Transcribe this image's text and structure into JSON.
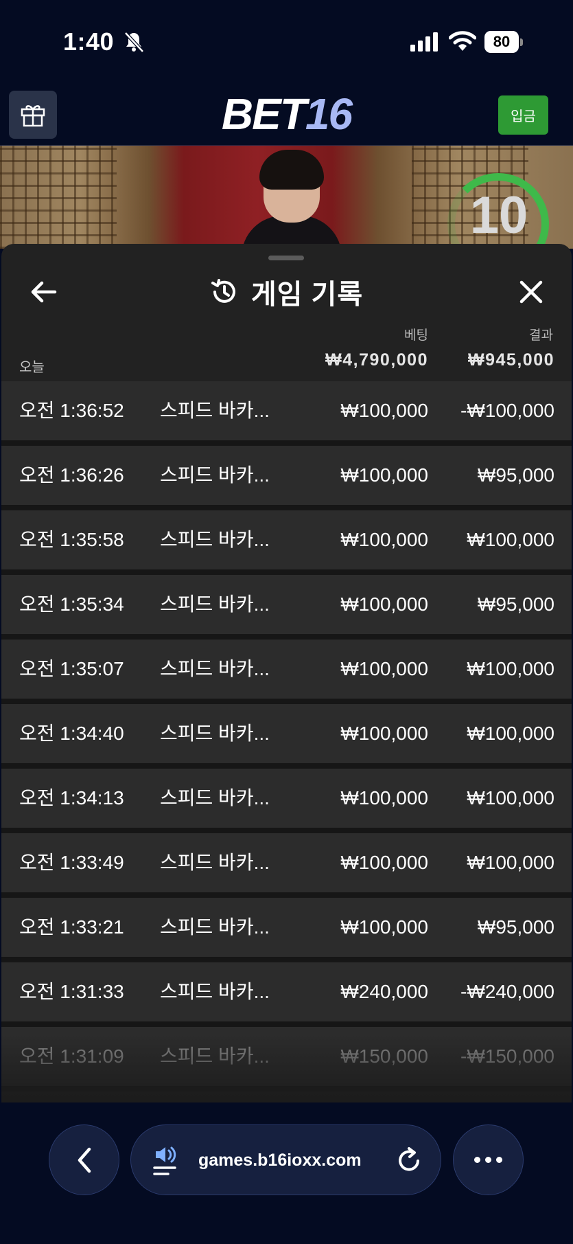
{
  "status_bar": {
    "time": "1:40",
    "battery": "80",
    "icons": [
      "bell-slash-icon",
      "signal-icon",
      "wifi-icon",
      "battery-charging-icon"
    ]
  },
  "header": {
    "logo_part1": "BET",
    "logo_part2": "16",
    "deposit_label": "입금",
    "gift_icon": "gift-icon"
  },
  "video": {
    "timer_value": "10",
    "timer_color": "#3fb94a"
  },
  "panel": {
    "title": "게임 기록",
    "col_bet": "베팅",
    "col_result": "결과",
    "today_label": "오늘",
    "total_bet": "₩4,790,000",
    "total_result": "₩945,000",
    "rows": [
      {
        "time": "오전 1:36:52",
        "game": "스피드 바카...",
        "bet": "₩100,000",
        "result": "-₩100,000"
      },
      {
        "time": "오전 1:36:26",
        "game": "스피드 바카...",
        "bet": "₩100,000",
        "result": "₩95,000"
      },
      {
        "time": "오전 1:35:58",
        "game": "스피드 바카...",
        "bet": "₩100,000",
        "result": "₩100,000"
      },
      {
        "time": "오전 1:35:34",
        "game": "스피드 바카...",
        "bet": "₩100,000",
        "result": "₩95,000"
      },
      {
        "time": "오전 1:35:07",
        "game": "스피드 바카...",
        "bet": "₩100,000",
        "result": "₩100,000"
      },
      {
        "time": "오전 1:34:40",
        "game": "스피드 바카...",
        "bet": "₩100,000",
        "result": "₩100,000"
      },
      {
        "time": "오전 1:34:13",
        "game": "스피드 바카...",
        "bet": "₩100,000",
        "result": "₩100,000"
      },
      {
        "time": "오전 1:33:49",
        "game": "스피드 바카...",
        "bet": "₩100,000",
        "result": "₩100,000"
      },
      {
        "time": "오전 1:33:21",
        "game": "스피드 바카...",
        "bet": "₩100,000",
        "result": "₩95,000"
      },
      {
        "time": "오전 1:31:33",
        "game": "스피드 바카...",
        "bet": "₩240,000",
        "result": "-₩240,000"
      },
      {
        "time": "오전 1:31:09",
        "game": "스피드 바카...",
        "bet": "₩150,000",
        "result": "-₩150,000"
      }
    ]
  },
  "browser": {
    "url": "games.b16ioxx.com"
  },
  "colors": {
    "background": "#040b22",
    "panel": "#222222",
    "row": "#2c2c2c",
    "deposit_green": "#2e9a34",
    "logo_accent": "#a8b8f4"
  }
}
